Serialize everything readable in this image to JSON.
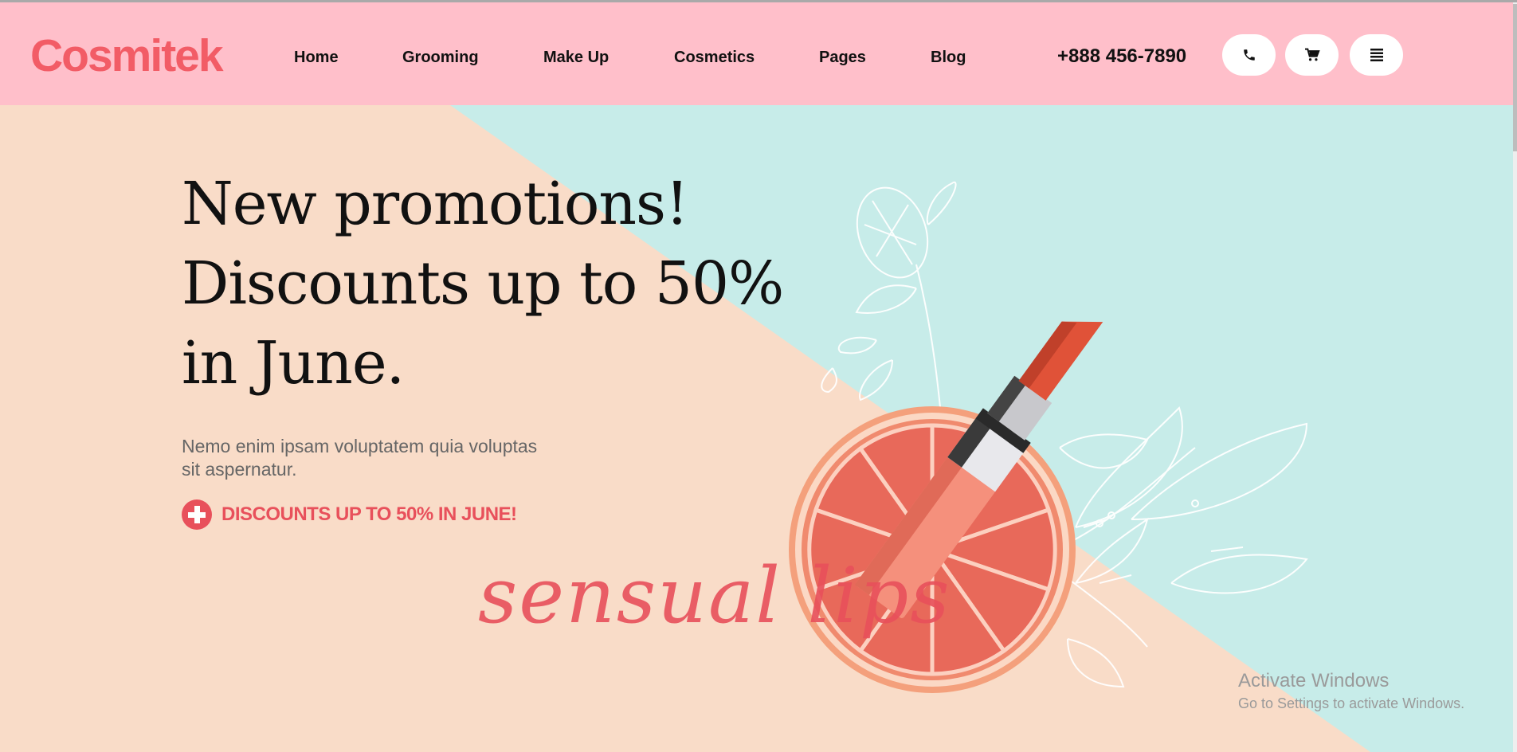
{
  "header": {
    "logo": "Cosmitek",
    "nav": [
      "Home",
      "Grooming",
      "Make Up",
      "Cosmetics",
      "Pages",
      "Blog"
    ],
    "phone": "+888 456-7890",
    "icons": [
      "phone-icon",
      "cart-icon",
      "menu-icon"
    ]
  },
  "hero": {
    "headline": [
      "New promotions!",
      "Discounts up to 50%",
      "in June."
    ],
    "description": "Nemo enim ipsam voluptatem quia voluptas sit aspernatur.",
    "promo_label": "DISCOUNTS UP TO 50% IN JUNE!",
    "script_text": "sensual lips"
  },
  "watermark": {
    "title": "Activate Windows",
    "subtitle": "Go to Settings to activate Windows."
  },
  "colors": {
    "header_bg": "#ffbfca",
    "accent": "#f25c66",
    "peach": "#f9dcc8",
    "mint": "#c7ece9"
  }
}
